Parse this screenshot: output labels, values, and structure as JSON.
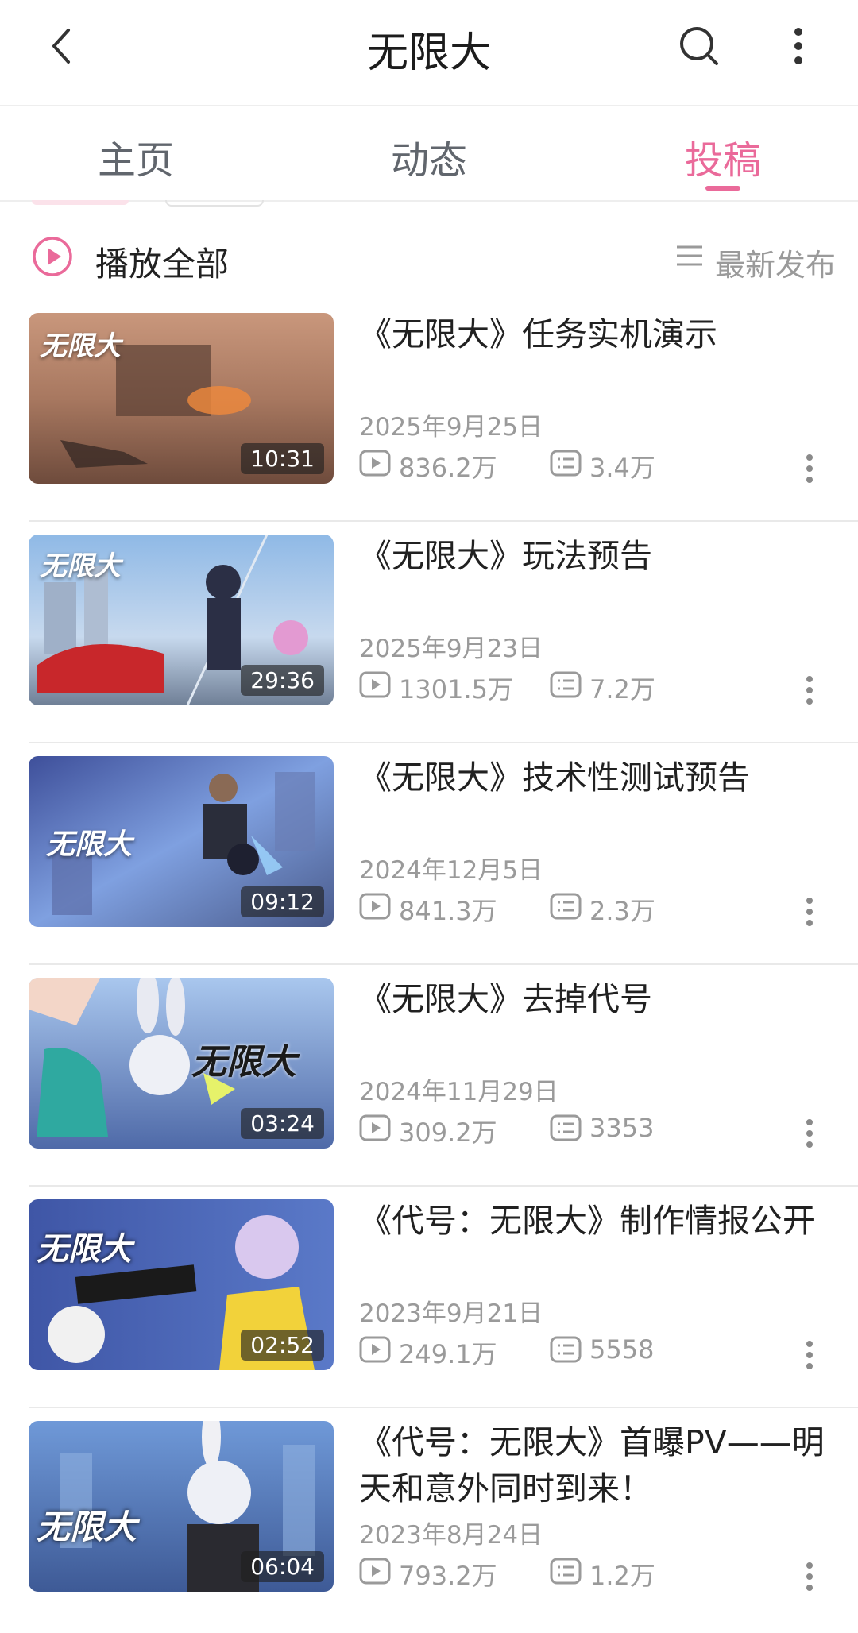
{
  "header": {
    "title": "无限大",
    "back_icon": "back-arrow-icon",
    "search_icon": "search-icon",
    "more_icon": "more-vertical-icon"
  },
  "tabs": [
    {
      "label": "主页",
      "active": false
    },
    {
      "label": "动态",
      "active": false
    },
    {
      "label": "投稿",
      "active": true
    }
  ],
  "toolbar": {
    "play_all": "播放全部",
    "sort": "最新发布"
  },
  "colors": {
    "accent": "#ea6a9a",
    "meta": "#9a9a9a",
    "text": "#212121"
  },
  "videos": [
    {
      "title": "《无限大》任务实机演示",
      "date": "2025年9月25日",
      "views": "836.2万",
      "danmaku": "3.4万",
      "duration": "10:31",
      "thumb_logo": "无限大"
    },
    {
      "title": "《无限大》玩法预告",
      "date": "2025年9月23日",
      "views": "1301.5万",
      "danmaku": "7.2万",
      "duration": "29:36",
      "thumb_logo": "无限大"
    },
    {
      "title": "《无限大》技术性测试预告",
      "date": "2024年12月5日",
      "views": "841.3万",
      "danmaku": "2.3万",
      "duration": "09:12",
      "thumb_logo": "无限大"
    },
    {
      "title": "《无限大》去掉代号",
      "date": "2024年11月29日",
      "views": "309.2万",
      "danmaku": "3353",
      "duration": "03:24",
      "thumb_logo": "无限大"
    },
    {
      "title": "《代号：无限大》制作情报公开",
      "date": "2023年9月21日",
      "views": "249.1万",
      "danmaku": "5558",
      "duration": "02:52",
      "thumb_logo": "无限大"
    },
    {
      "title": "《代号：无限大》首曝PV——明天和意外同时到来！",
      "date": "2023年8月24日",
      "views": "793.2万",
      "danmaku": "1.2万",
      "duration": "06:04",
      "thumb_logo": "无限大"
    }
  ]
}
